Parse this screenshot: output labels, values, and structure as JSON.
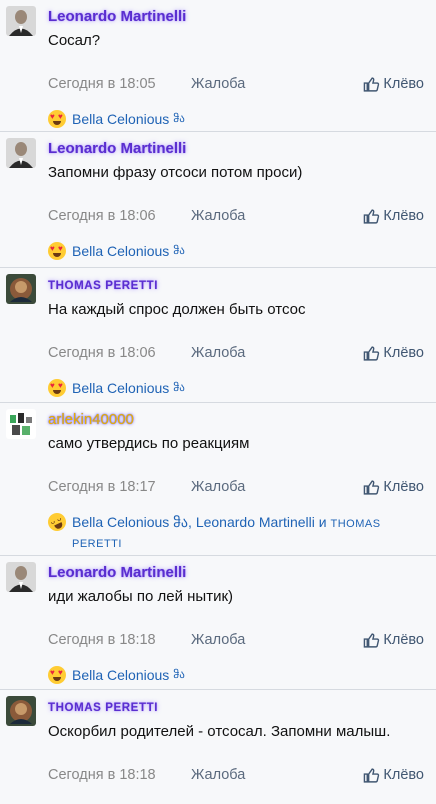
{
  "colors": {
    "name_purple": "#5a2ecf",
    "name_gold": "#e7b200",
    "link_blue": "#1f63b5",
    "meta_gray": "#888888"
  },
  "labels": {
    "report": "Жалоба",
    "like": "Клёво"
  },
  "posts": [
    {
      "author": "Leonardo Martinelli",
      "text": "Сосал?",
      "date": "Сегодня в 18:05",
      "reaction_emoji": "heart-eyes-emoji",
      "reactors": "Bella Celonious",
      "reactors_suffix": "ჵა"
    },
    {
      "author": "Leonardo Martinelli",
      "text": "Запомни фразу отсоси потом проси)",
      "date": "Сегодня в 18:06",
      "reaction_emoji": "heart-eyes-emoji",
      "reactors": "Bella Celonious",
      "reactors_suffix": "ჵა"
    },
    {
      "author": "THOMAS PERETTI",
      "text": "На каждый спрос должен быть отсос",
      "date": "Сегодня в 18:06",
      "reaction_emoji": "heart-eyes-emoji",
      "reactors": "Bella Celonious",
      "reactors_suffix": "ჵა"
    },
    {
      "author": "arlekin40000",
      "text": "само утвердись по реакциям",
      "date": "Сегодня в 18:17",
      "reaction_emoji": "rofl-emoji",
      "reactors": "Bella Celonious ჵა, Leonardo Martinelli и",
      "reactors_suffix": "THOMAS",
      "reactors_line2": "PERETTI"
    },
    {
      "author": "Leonardo Martinelli",
      "text": "иди жалобы по лей нытик)",
      "date": "Сегодня в 18:18",
      "reaction_emoji": "heart-eyes-emoji",
      "reactors": "Bella Celonious",
      "reactors_suffix": "ჵა"
    },
    {
      "author": "THOMAS PERETTI",
      "text": "Оскорбил родителей - отсосал. Запомни малыш.",
      "date": "Сегодня в 18:18"
    }
  ]
}
